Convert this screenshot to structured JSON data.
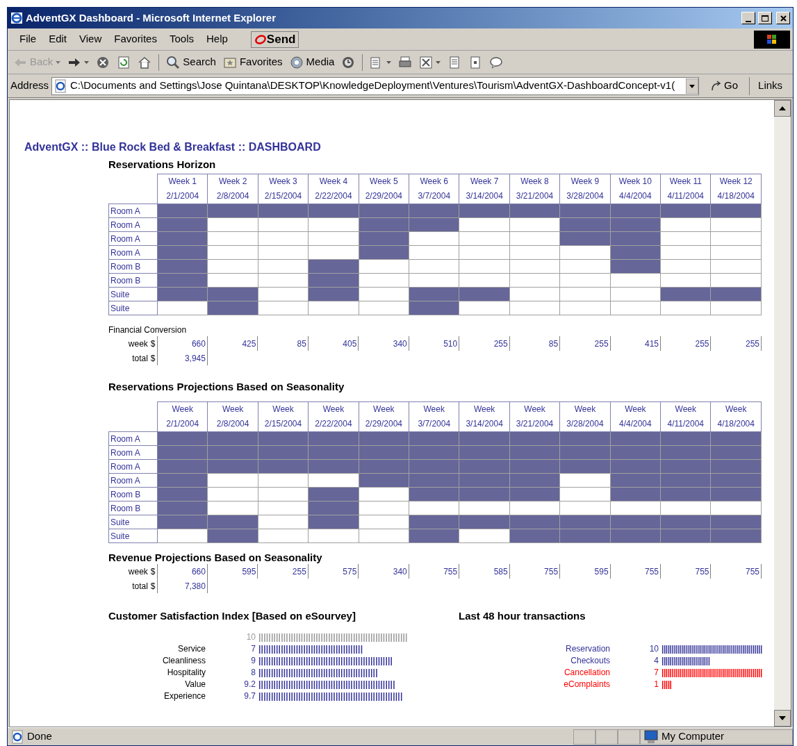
{
  "window": {
    "title": "AdventGX Dashboard - Microsoft Internet Explorer"
  },
  "menu": [
    "File",
    "Edit",
    "View",
    "Favorites",
    "Tools",
    "Help"
  ],
  "send_button": "Send",
  "toolbar": [
    {
      "kind": "back",
      "label": "Back",
      "disabled": true
    },
    {
      "kind": "forward",
      "disabled": false
    },
    {
      "kind": "stop",
      "disabled": false
    },
    {
      "kind": "refresh",
      "disabled": false
    },
    {
      "kind": "home",
      "disabled": false
    },
    {
      "kind": "search",
      "label": "Search",
      "disabled": false
    },
    {
      "kind": "favorites",
      "label": "Favorites",
      "disabled": false
    },
    {
      "kind": "media",
      "label": "Media",
      "disabled": false
    },
    {
      "kind": "history",
      "disabled": false
    },
    {
      "kind": "mail",
      "disabled": false
    },
    {
      "kind": "print",
      "disabled": false
    },
    {
      "kind": "edit",
      "disabled": false
    },
    {
      "kind": "discuss",
      "disabled": false
    },
    {
      "kind": "research",
      "disabled": false
    },
    {
      "kind": "messenger",
      "disabled": false
    }
  ],
  "address": {
    "label": "Address",
    "value": "C:\\Documents and Settings\\Jose Quintana\\DESKTOP\\KnowledgeDeployment\\Ventures\\Tourism\\AdventGX-DashboardConcept-v1(",
    "go": "Go",
    "links": "Links"
  },
  "page": {
    "heading": "AdventGX :: Blue Rock Bed & Breakfast :: DASHBOARD",
    "horizon": {
      "title": "Reservations Horizon",
      "columns": [
        {
          "week": "Week 1",
          "date": "2/1/2004"
        },
        {
          "week": "Week 2",
          "date": "2/8/2004"
        },
        {
          "week": "Week 3",
          "date": "2/15/2004"
        },
        {
          "week": "Week 4",
          "date": "2/22/2004"
        },
        {
          "week": "Week 5",
          "date": "2/29/2004"
        },
        {
          "week": "Week 6",
          "date": "3/7/2004"
        },
        {
          "week": "Week 7",
          "date": "3/14/2004"
        },
        {
          "week": "Week 8",
          "date": "3/21/2004"
        },
        {
          "week": "Week 9",
          "date": "3/28/2004"
        },
        {
          "week": "Week 10",
          "date": "4/4/2004"
        },
        {
          "week": "Week 11",
          "date": "4/11/2004"
        },
        {
          "week": "Week 12",
          "date": "4/18/2004"
        }
      ],
      "rows": [
        {
          "label": "Room A",
          "booked": [
            true,
            true,
            true,
            true,
            true,
            true,
            true,
            true,
            true,
            true,
            true,
            true
          ]
        },
        {
          "label": "Room A",
          "booked": [
            true,
            false,
            false,
            false,
            true,
            true,
            false,
            false,
            true,
            true,
            false,
            false
          ]
        },
        {
          "label": "Room A",
          "booked": [
            true,
            false,
            false,
            false,
            true,
            false,
            false,
            false,
            true,
            true,
            false,
            false
          ]
        },
        {
          "label": "Room A",
          "booked": [
            true,
            false,
            false,
            false,
            true,
            false,
            false,
            false,
            false,
            true,
            false,
            false
          ]
        },
        {
          "label": "Room B",
          "booked": [
            true,
            false,
            false,
            true,
            false,
            false,
            false,
            false,
            false,
            true,
            false,
            false
          ]
        },
        {
          "label": "Room B",
          "booked": [
            true,
            false,
            false,
            true,
            false,
            false,
            false,
            false,
            false,
            false,
            false,
            false
          ]
        },
        {
          "label": "Suite",
          "booked": [
            true,
            true,
            false,
            true,
            false,
            true,
            true,
            false,
            false,
            false,
            true,
            true
          ]
        },
        {
          "label": "Suite",
          "booked": [
            false,
            true,
            false,
            false,
            false,
            true,
            false,
            false,
            false,
            false,
            false,
            false
          ]
        }
      ]
    },
    "financial": {
      "title": "Financial Conversion",
      "week_label": "week",
      "total_label": "total",
      "currency": "$",
      "week_values": [
        "660",
        "425",
        "85",
        "405",
        "340",
        "510",
        "255",
        "85",
        "255",
        "415",
        "255",
        "255"
      ],
      "total": "3,945"
    },
    "projections": {
      "title": "Reservations Projections Based on Seasonality",
      "columns": [
        {
          "week": "Week",
          "date": "2/1/2004"
        },
        {
          "week": "Week",
          "date": "2/8/2004"
        },
        {
          "week": "Week",
          "date": "2/15/2004"
        },
        {
          "week": "Week",
          "date": "2/22/2004"
        },
        {
          "week": "Week",
          "date": "2/29/2004"
        },
        {
          "week": "Week",
          "date": "3/7/2004"
        },
        {
          "week": "Week",
          "date": "3/14/2004"
        },
        {
          "week": "Week",
          "date": "3/21/2004"
        },
        {
          "week": "Week",
          "date": "3/28/2004"
        },
        {
          "week": "Week",
          "date": "4/4/2004"
        },
        {
          "week": "Week",
          "date": "4/11/2004"
        },
        {
          "week": "Week",
          "date": "4/18/2004"
        }
      ],
      "rows": [
        {
          "label": "Room A",
          "booked": [
            true,
            true,
            true,
            true,
            true,
            true,
            true,
            true,
            true,
            true,
            true,
            true
          ]
        },
        {
          "label": "Room A",
          "booked": [
            true,
            true,
            true,
            true,
            true,
            true,
            true,
            true,
            true,
            true,
            true,
            true
          ]
        },
        {
          "label": "Room A",
          "booked": [
            true,
            true,
            true,
            true,
            true,
            true,
            true,
            true,
            true,
            true,
            true,
            true
          ]
        },
        {
          "label": "Room A",
          "booked": [
            true,
            false,
            false,
            false,
            true,
            true,
            true,
            true,
            false,
            true,
            true,
            true
          ]
        },
        {
          "label": "Room B",
          "booked": [
            true,
            false,
            false,
            true,
            false,
            true,
            true,
            true,
            false,
            true,
            true,
            true
          ]
        },
        {
          "label": "Room B",
          "booked": [
            true,
            false,
            false,
            true,
            false,
            false,
            false,
            false,
            false,
            false,
            false,
            false
          ]
        },
        {
          "label": "Suite",
          "booked": [
            true,
            true,
            false,
            true,
            false,
            true,
            true,
            true,
            true,
            true,
            true,
            true
          ]
        },
        {
          "label": "Suite",
          "booked": [
            false,
            true,
            false,
            false,
            false,
            true,
            false,
            true,
            true,
            true,
            true,
            true
          ]
        }
      ]
    },
    "revenue": {
      "title": "Revenue Projections Based on Seasonality",
      "week_label": "week",
      "total_label": "total",
      "currency": "$",
      "week_values": [
        "660",
        "595",
        "255",
        "575",
        "340",
        "755",
        "585",
        "755",
        "595",
        "755",
        "755",
        "755"
      ],
      "total": "7,380"
    },
    "satisfaction": {
      "title": "Customer Satisfaction Index [Based on eSourvey]",
      "scale": {
        "value": "10",
        "bar": "||||||||||||||||||||||||||||||||||||||||||||||||||||||||||||",
        "color": "#999999"
      },
      "items": [
        {
          "label": "Service",
          "value": "7",
          "bar": "||||||||||||||||||||||||||||||||||||||||||",
          "color": "#333399"
        },
        {
          "label": "Cleanliness",
          "value": "9",
          "bar": "||||||||||||||||||||||||||||||||||||||||||||||||||||||",
          "color": "#333399"
        },
        {
          "label": "Hospitality",
          "value": "8",
          "bar": "||||||||||||||||||||||||||||||||||||||||||||||||",
          "color": "#333399"
        },
        {
          "label": "Value",
          "value": "9.2",
          "bar": "|||||||||||||||||||||||||||||||||||||||||||||||||||||||",
          "color": "#333399"
        },
        {
          "label": "Experience",
          "value": "9.7",
          "bar": "||||||||||||||||||||||||||||||||||||||||||||||||||||||||||",
          "color": "#333399"
        }
      ]
    },
    "transactions": {
      "title": "Last 48 hour transactions",
      "items": [
        {
          "label": "Reservation",
          "value": "10",
          "bar": "||||||||||||||||||||||||||||||||||||||||||||||||||",
          "color": "#333399"
        },
        {
          "label": "Checkouts",
          "value": "4",
          "bar": "||||||||||||||||||||||||",
          "color": "#333399"
        },
        {
          "label": "Cancellation",
          "value": "7",
          "bar": "||||||||||||||||||||||||||||||||||||||||||||||||||",
          "color": "#ff0000"
        },
        {
          "label": "eComplaints",
          "value": "1",
          "bar": "|||||",
          "color": "#ff0000"
        }
      ]
    }
  },
  "status_bar": {
    "text": "Done",
    "zone": "My Computer"
  }
}
